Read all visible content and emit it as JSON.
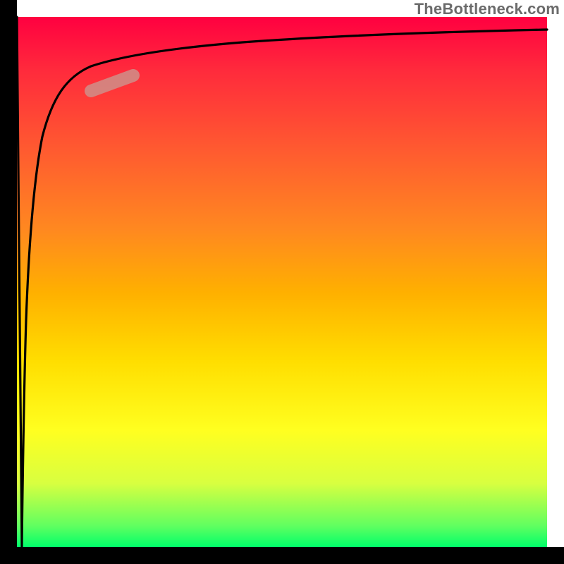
{
  "watermark": "TheBottleneck.com",
  "chart_data": {
    "type": "line",
    "title": "",
    "xlabel": "",
    "ylabel": "",
    "xlim": [
      0,
      100
    ],
    "ylim": [
      0,
      100
    ],
    "grid": false,
    "legend": false,
    "background": "vertical red→orange→yellow→green gradient",
    "series": [
      {
        "name": "curve",
        "color": "#000000",
        "x": [
          0,
          1,
          1.5,
          2,
          3,
          4,
          5,
          7,
          10,
          15,
          20,
          30,
          50,
          70,
          100
        ],
        "y": [
          100,
          0,
          20,
          40,
          60,
          70,
          76,
          82,
          86,
          89,
          91,
          93,
          95,
          96,
          97
        ]
      },
      {
        "name": "highlight-segment",
        "color": "#cf8f8a",
        "x": [
          14,
          22
        ],
        "y": [
          86,
          89
        ]
      }
    ],
    "notes": "Black curve rises steeply from (≈1,0) toward an asymptote near y≈97. A short salmon-colored thick segment overlays the curve roughly over x≈14–22."
  }
}
